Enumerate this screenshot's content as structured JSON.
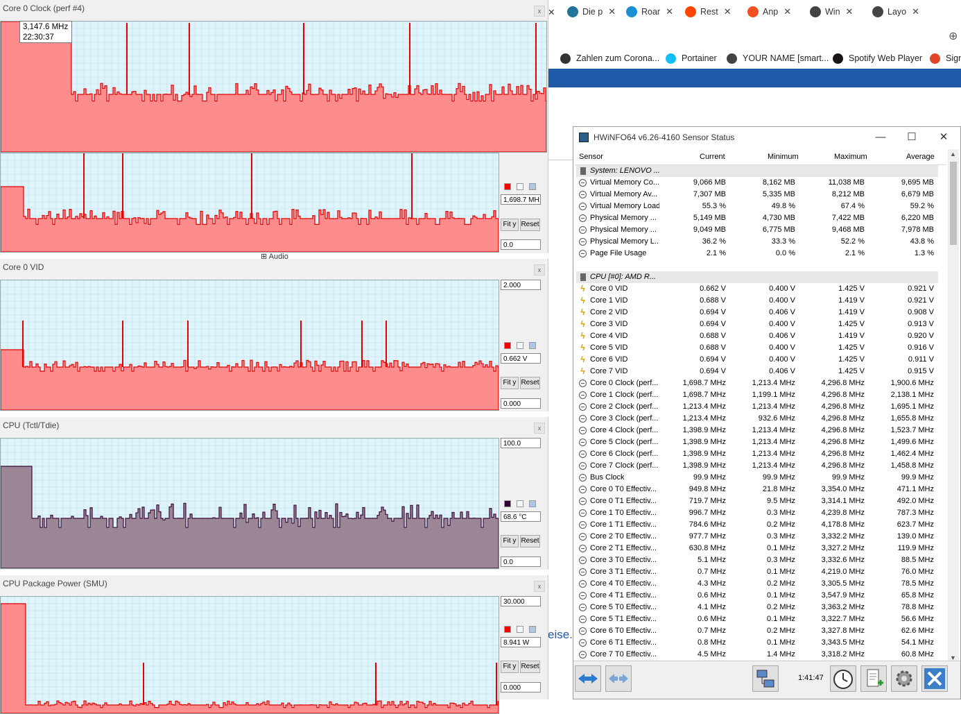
{
  "browser": {
    "tabs": [
      {
        "label": "Die p",
        "color": "#21759b"
      },
      {
        "label": "Roar",
        "color": "#1a8fd4"
      },
      {
        "label": "Rest",
        "color": "#ff4500"
      },
      {
        "label": "Anp",
        "color": "#f25022"
      },
      {
        "label": "Win",
        "color": "#444444"
      },
      {
        "label": "Layo",
        "color": "#444444"
      }
    ],
    "close_glyph": "✕",
    "new_tab": "⊕",
    "bookmarks": [
      {
        "label": "Zahlen zum Corona...",
        "color": "#333333"
      },
      {
        "label": "Portainer",
        "color": "#13bef9"
      },
      {
        "label": "YOUR NAME [smart...",
        "color": "#444444"
      },
      {
        "label": "Spotify Web Player",
        "color": "#191414"
      },
      {
        "label": "Sign",
        "color": "#e24329"
      }
    ],
    "bg_text_audio": "Audio",
    "bg_text_site": "eise.zi"
  },
  "graphs": [
    {
      "id": "core0-clock",
      "title": "Core 0 Clock (perf #4)",
      "tooltip_value": "3,147.6 MHz",
      "tooltip_time": "22:30:37"
    },
    {
      "id": "core0-clock-lower",
      "title": "",
      "max": "",
      "current": "1,698.7 MH:",
      "min": "0.0",
      "color": "#ff0000"
    },
    {
      "id": "core0-vid",
      "title": "Core 0 VID",
      "max": "2.000",
      "current": "0.662  V",
      "min": "0.000",
      "color": "#ff0000"
    },
    {
      "id": "cpu-tctl",
      "title": "CPU (Tctl/Tdie)",
      "max": "100.0",
      "current": "68.6 °C",
      "min": "0.0",
      "color": "#330033"
    },
    {
      "id": "cpu-package-power",
      "title": "CPU Package Power (SMU)",
      "max": "30.000",
      "current": "8.941  W",
      "min": "0.000",
      "color": "#ff0000"
    }
  ],
  "graph_buttons": {
    "fit": "Fit y",
    "reset": "Reset"
  },
  "hwinfo": {
    "title": "HWiNFO64 v6.26-4160 Sensor Status",
    "window_controls": {
      "minimize": "—",
      "maximize": "☐",
      "close": "✕"
    },
    "columns": [
      "Sensor",
      "Current",
      "Minimum",
      "Maximum",
      "Average"
    ],
    "rows": [
      {
        "type": "group",
        "icon": "chip",
        "name": "System: LENOVO ..."
      },
      {
        "type": "row",
        "icon": "clock",
        "name": "Virtual Memory Co...",
        "cur": "9,066 MB",
        "min": "8,162 MB",
        "max": "11,038 MB",
        "avg": "9,695 MB"
      },
      {
        "type": "row",
        "icon": "clock",
        "name": "Virtual Memory Av...",
        "cur": "7,307 MB",
        "min": "5,335 MB",
        "max": "8,212 MB",
        "avg": "6,679 MB"
      },
      {
        "type": "row",
        "icon": "clock",
        "name": "Virtual Memory Load",
        "cur": "55.3 %",
        "min": "49.8 %",
        "max": "67.4 %",
        "avg": "59.2 %"
      },
      {
        "type": "row",
        "icon": "clock",
        "name": "Physical Memory ...",
        "cur": "5,149 MB",
        "min": "4,730 MB",
        "max": "7,422 MB",
        "avg": "6,220 MB"
      },
      {
        "type": "row",
        "icon": "clock",
        "name": "Physical Memory ...",
        "cur": "9,049 MB",
        "min": "6,775 MB",
        "max": "9,468 MB",
        "avg": "7,978 MB"
      },
      {
        "type": "row",
        "icon": "clock",
        "name": "Physical Memory L...",
        "cur": "36.2 %",
        "min": "33.3 %",
        "max": "52.2 %",
        "avg": "43.8 %"
      },
      {
        "type": "row",
        "icon": "clock",
        "name": "Page File Usage",
        "cur": "2.1 %",
        "min": "0.0 %",
        "max": "2.1 %",
        "avg": "1.3 %"
      },
      {
        "type": "blank"
      },
      {
        "type": "group",
        "icon": "chip",
        "name": "CPU [#0]: AMD R..."
      },
      {
        "type": "row",
        "icon": "volt",
        "name": "Core 0 VID",
        "cur": "0.662 V",
        "min": "0.400 V",
        "max": "1.425 V",
        "avg": "0.921 V"
      },
      {
        "type": "row",
        "icon": "volt",
        "name": "Core 1 VID",
        "cur": "0.688 V",
        "min": "0.400 V",
        "max": "1.419 V",
        "avg": "0.921 V"
      },
      {
        "type": "row",
        "icon": "volt",
        "name": "Core 2 VID",
        "cur": "0.694 V",
        "min": "0.406 V",
        "max": "1.419 V",
        "avg": "0.908 V"
      },
      {
        "type": "row",
        "icon": "volt",
        "name": "Core 3 VID",
        "cur": "0.694 V",
        "min": "0.400 V",
        "max": "1.425 V",
        "avg": "0.913 V"
      },
      {
        "type": "row",
        "icon": "volt",
        "name": "Core 4 VID",
        "cur": "0.688 V",
        "min": "0.406 V",
        "max": "1.419 V",
        "avg": "0.920 V"
      },
      {
        "type": "row",
        "icon": "volt",
        "name": "Core 5 VID",
        "cur": "0.688 V",
        "min": "0.400 V",
        "max": "1.425 V",
        "avg": "0.916 V"
      },
      {
        "type": "row",
        "icon": "volt",
        "name": "Core 6 VID",
        "cur": "0.694 V",
        "min": "0.400 V",
        "max": "1.425 V",
        "avg": "0.911 V"
      },
      {
        "type": "row",
        "icon": "volt",
        "name": "Core 7 VID",
        "cur": "0.694 V",
        "min": "0.406 V",
        "max": "1.425 V",
        "avg": "0.915 V"
      },
      {
        "type": "row",
        "icon": "clock",
        "name": "Core 0 Clock (perf...",
        "cur": "1,698.7 MHz",
        "min": "1,213.4 MHz",
        "max": "4,296.8 MHz",
        "avg": "1,900.6 MHz"
      },
      {
        "type": "row",
        "icon": "clock",
        "name": "Core 1 Clock (perf...",
        "cur": "1,698.7 MHz",
        "min": "1,199.1 MHz",
        "max": "4,296.8 MHz",
        "avg": "2,138.1 MHz"
      },
      {
        "type": "row",
        "icon": "clock",
        "name": "Core 2 Clock (perf...",
        "cur": "1,213.4 MHz",
        "min": "1,213.4 MHz",
        "max": "4,296.8 MHz",
        "avg": "1,695.1 MHz"
      },
      {
        "type": "row",
        "icon": "clock",
        "name": "Core 3 Clock (perf...",
        "cur": "1,213.4 MHz",
        "min": "932.6 MHz",
        "max": "4,296.8 MHz",
        "avg": "1,655.8 MHz"
      },
      {
        "type": "row",
        "icon": "clock",
        "name": "Core 4 Clock (perf...",
        "cur": "1,398.9 MHz",
        "min": "1,213.4 MHz",
        "max": "4,296.8 MHz",
        "avg": "1,523.7 MHz"
      },
      {
        "type": "row",
        "icon": "clock",
        "name": "Core 5 Clock (perf...",
        "cur": "1,398.9 MHz",
        "min": "1,213.4 MHz",
        "max": "4,296.8 MHz",
        "avg": "1,499.6 MHz"
      },
      {
        "type": "row",
        "icon": "clock",
        "name": "Core 6 Clock (perf...",
        "cur": "1,398.9 MHz",
        "min": "1,213.4 MHz",
        "max": "4,296.8 MHz",
        "avg": "1,462.4 MHz"
      },
      {
        "type": "row",
        "icon": "clock",
        "name": "Core 7 Clock (perf...",
        "cur": "1,398.9 MHz",
        "min": "1,213.4 MHz",
        "max": "4,296.8 MHz",
        "avg": "1,458.8 MHz"
      },
      {
        "type": "row",
        "icon": "clock",
        "name": "Bus Clock",
        "cur": "99.9 MHz",
        "min": "99.9 MHz",
        "max": "99.9 MHz",
        "avg": "99.9 MHz"
      },
      {
        "type": "row",
        "icon": "clock",
        "name": "Core 0 T0 Effectiv...",
        "cur": "949.8 MHz",
        "min": "21.8 MHz",
        "max": "3,354.0 MHz",
        "avg": "471.1 MHz"
      },
      {
        "type": "row",
        "icon": "clock",
        "name": "Core 0 T1 Effectiv...",
        "cur": "719.7 MHz",
        "min": "9.5 MHz",
        "max": "3,314.1 MHz",
        "avg": "492.0 MHz"
      },
      {
        "type": "row",
        "icon": "clock",
        "name": "Core 1 T0 Effectiv...",
        "cur": "996.7 MHz",
        "min": "0.3 MHz",
        "max": "4,239.8 MHz",
        "avg": "787.3 MHz"
      },
      {
        "type": "row",
        "icon": "clock",
        "name": "Core 1 T1 Effectiv...",
        "cur": "784.6 MHz",
        "min": "0.2 MHz",
        "max": "4,178.8 MHz",
        "avg": "623.7 MHz"
      },
      {
        "type": "row",
        "icon": "clock",
        "name": "Core 2 T0 Effectiv...",
        "cur": "977.7 MHz",
        "min": "0.3 MHz",
        "max": "3,332.2 MHz",
        "avg": "139.0 MHz"
      },
      {
        "type": "row",
        "icon": "clock",
        "name": "Core 2 T1 Effectiv...",
        "cur": "630.8 MHz",
        "min": "0.1 MHz",
        "max": "3,327.2 MHz",
        "avg": "119.9 MHz"
      },
      {
        "type": "row",
        "icon": "clock",
        "name": "Core 3 T0 Effectiv...",
        "cur": "5.1 MHz",
        "min": "0.3 MHz",
        "max": "3,332.6 MHz",
        "avg": "88.5 MHz"
      },
      {
        "type": "row",
        "icon": "clock",
        "name": "Core 3 T1 Effectiv...",
        "cur": "0.7 MHz",
        "min": "0.1 MHz",
        "max": "4,219.0 MHz",
        "avg": "76.0 MHz"
      },
      {
        "type": "row",
        "icon": "clock",
        "name": "Core 4 T0 Effectiv...",
        "cur": "4.3 MHz",
        "min": "0.2 MHz",
        "max": "3,305.5 MHz",
        "avg": "78.5 MHz"
      },
      {
        "type": "row",
        "icon": "clock",
        "name": "Core 4 T1 Effectiv...",
        "cur": "0.6 MHz",
        "min": "0.1 MHz",
        "max": "3,547.9 MHz",
        "avg": "65.8 MHz"
      },
      {
        "type": "row",
        "icon": "clock",
        "name": "Core 5 T0 Effectiv...",
        "cur": "4.1 MHz",
        "min": "0.2 MHz",
        "max": "3,363.2 MHz",
        "avg": "78.8 MHz"
      },
      {
        "type": "row",
        "icon": "clock",
        "name": "Core 5 T1 Effectiv...",
        "cur": "0.6 MHz",
        "min": "0.1 MHz",
        "max": "3,322.7 MHz",
        "avg": "56.6 MHz"
      },
      {
        "type": "row",
        "icon": "clock",
        "name": "Core 6 T0 Effectiv...",
        "cur": "0.7 MHz",
        "min": "0.2 MHz",
        "max": "3,327.8 MHz",
        "avg": "62.6 MHz"
      },
      {
        "type": "row",
        "icon": "clock",
        "name": "Core 6 T1 Effectiv...",
        "cur": "0.8 MHz",
        "min": "0.1 MHz",
        "max": "3,343.5 MHz",
        "avg": "54.1 MHz"
      },
      {
        "type": "row",
        "icon": "clock",
        "name": "Core 7 T0 Effectiv...",
        "cur": "4.5 MHz",
        "min": "1.4 MHz",
        "max": "3,318.2 MHz",
        "avg": "60.8 MHz"
      }
    ],
    "timer": "1:41:47"
  }
}
